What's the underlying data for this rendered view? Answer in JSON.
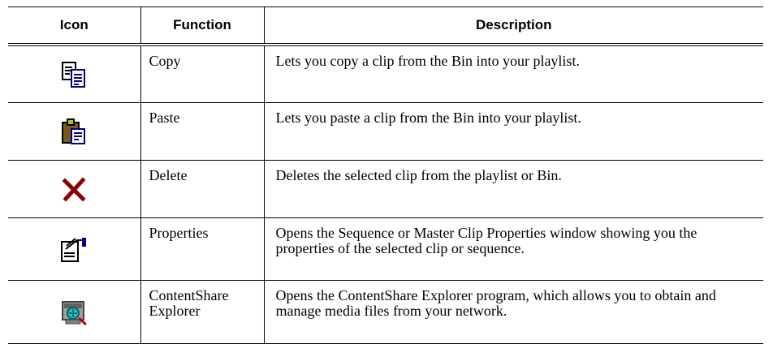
{
  "table": {
    "headers": [
      "Icon",
      "Function",
      "Description"
    ],
    "rows": [
      {
        "icon": "copy-icon",
        "function": "Copy",
        "description": "Lets you copy a clip from the Bin into your playlist."
      },
      {
        "icon": "paste-icon",
        "function": "Paste",
        "description": "Lets you paste a clip from the Bin into your playlist."
      },
      {
        "icon": "delete-icon",
        "function": "Delete",
        "description": "Deletes the selected clip from the playlist or Bin."
      },
      {
        "icon": "properties-icon",
        "function": "Properties",
        "description": "Opens the Sequence or Master Clip Properties window showing you the properties of the selected clip or sequence."
      },
      {
        "icon": "contentshare-explorer-icon",
        "function": "ContentShare Explorer",
        "description": "Opens the ContentShare Explorer program, which allows you to obtain and manage media files from your network."
      }
    ]
  }
}
